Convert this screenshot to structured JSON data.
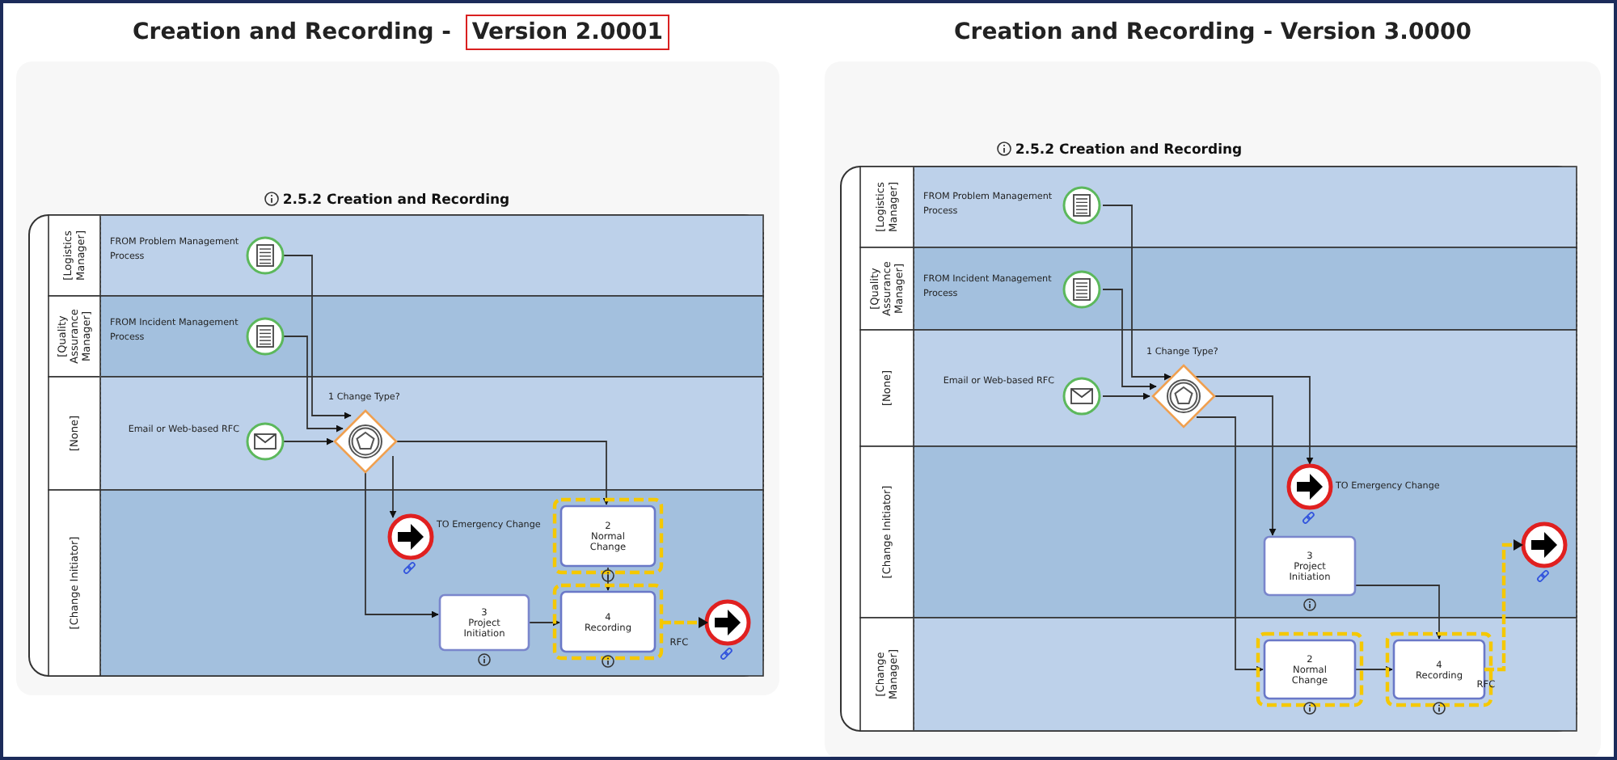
{
  "panels": [
    {
      "title_parts": [
        {
          "text": "Creation and Recording - ",
          "boxed": false
        },
        {
          "text": "Version 2.0001",
          "boxed": true
        }
      ],
      "diagram_title": "2.5.2 Creation and Recording",
      "lanes": [
        {
          "label_lines": [
            "[Logistics",
            "Manager]"
          ]
        },
        {
          "label_lines": [
            "[Quality",
            "Assurance",
            "Manager]"
          ]
        },
        {
          "label_lines": [
            "[None]"
          ]
        },
        {
          "label_lines": [
            "[Change Initiator]"
          ]
        }
      ],
      "nodes": [
        {
          "kind": "document-start",
          "label_lines": [
            "FROM Problem Management",
            "Process"
          ]
        },
        {
          "kind": "document-start",
          "label_lines": [
            "FROM Incident Management",
            "Process"
          ]
        },
        {
          "kind": "message-start",
          "label_lines": [
            "Email or Web-based RFC"
          ]
        },
        {
          "kind": "gateway",
          "label_lines": [
            "1 Change Type?"
          ]
        },
        {
          "kind": "link-end",
          "label_lines": [
            "TO Emergency Change"
          ]
        },
        {
          "kind": "task",
          "number": "3",
          "name_lines": [
            "Project",
            "Initiation"
          ],
          "highlighted": false
        },
        {
          "kind": "task",
          "number": "2",
          "name_lines": [
            "Normal",
            "Change"
          ],
          "highlighted": true
        },
        {
          "kind": "task",
          "number": "4",
          "name_lines": [
            "Recording"
          ],
          "highlighted": true
        },
        {
          "kind": "link-end"
        }
      ],
      "rfc_flow": {
        "label": "RFC",
        "highlighted": true
      }
    },
    {
      "title_parts": [
        {
          "text": "Creation and Recording - Version 3.0000",
          "boxed": false
        }
      ],
      "diagram_title": "2.5.2 Creation and Recording",
      "lanes": [
        {
          "label_lines": [
            "[Logistics",
            "Manager]"
          ]
        },
        {
          "label_lines": [
            "[Quality",
            "Assurance",
            "Manager]"
          ]
        },
        {
          "label_lines": [
            "[None]"
          ]
        },
        {
          "label_lines": [
            "[Change Initiator]"
          ]
        },
        {
          "label_lines": [
            "[Change",
            "Manager]"
          ]
        }
      ],
      "nodes": [
        {
          "kind": "document-start",
          "label_lines": [
            "FROM Problem Management",
            "Process"
          ]
        },
        {
          "kind": "document-start",
          "label_lines": [
            "FROM Incident Management",
            "Process"
          ]
        },
        {
          "kind": "message-start",
          "label_lines": [
            "Email or Web-based RFC"
          ]
        },
        {
          "kind": "gateway",
          "label_lines": [
            "1 Change Type?"
          ]
        },
        {
          "kind": "link-end",
          "label_lines": [
            "TO Emergency Change"
          ]
        },
        {
          "kind": "task",
          "number": "3",
          "name_lines": [
            "Project",
            "Initiation"
          ],
          "highlighted": false
        },
        {
          "kind": "task",
          "number": "2",
          "name_lines": [
            "Normal",
            "Change"
          ],
          "highlighted": true
        },
        {
          "kind": "task",
          "number": "4",
          "name_lines": [
            "Recording"
          ],
          "highlighted": true
        },
        {
          "kind": "link-end"
        }
      ],
      "rfc_flow": {
        "label": "RFC",
        "highlighted": true
      }
    }
  ]
}
